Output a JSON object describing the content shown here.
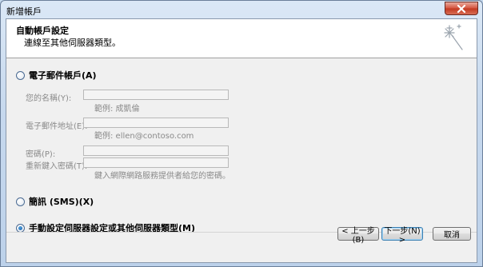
{
  "window": {
    "title": "新增帳戶"
  },
  "header": {
    "title": "自動帳戶設定",
    "subtitle": "連線至其他伺服器類型。",
    "icon": "wizard-sparkle-icon"
  },
  "options": {
    "email": {
      "label": "電子郵件帳戶(A)",
      "selected": false,
      "fields": {
        "name_label": "您的名稱(Y):",
        "name_value": "",
        "name_hint": "範例: 成凱倫",
        "email_label": "電子郵件地址(E):",
        "email_value": "",
        "email_hint": "範例: ellen@contoso.com",
        "password_label": "密碼(P):",
        "password_value": "",
        "retype_label": "重新鍵入密碼(T):",
        "retype_value": "",
        "password_hint": "鍵入網際網路服務提供者給您的密碼。"
      }
    },
    "sms": {
      "label": "簡訊 (SMS)(X)",
      "selected": false
    },
    "manual": {
      "label": "手動設定伺服器設定或其他伺服器類型(M)",
      "selected": true
    }
  },
  "buttons": {
    "back": "< 上一步(B)",
    "next": "下一步(N) >",
    "cancel": "取消"
  },
  "colors": {
    "titlebar": "#c7d9ee",
    "close": "#c2381f",
    "header_bg": "#ffffff",
    "body_bg": "#f0f0f0"
  }
}
